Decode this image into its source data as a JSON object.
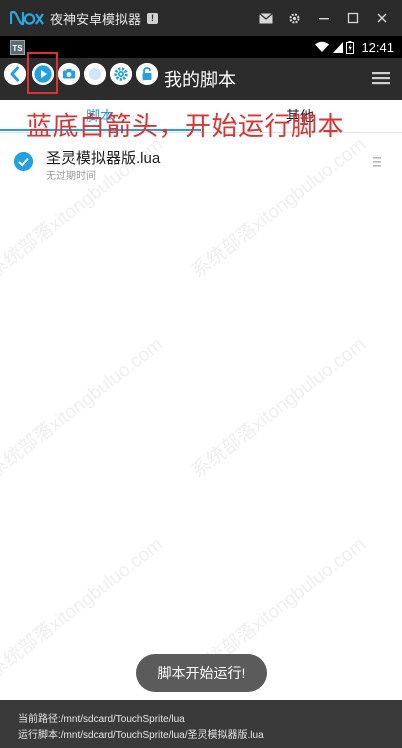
{
  "emulator": {
    "title": "夜神安卓模拟器",
    "badge": "!"
  },
  "status_bar": {
    "app_badge": "TS",
    "time": "12:41"
  },
  "toolbar": {
    "title": "我的脚本"
  },
  "tabs": [
    {
      "label": "脚本",
      "active": true
    },
    {
      "label": "其他",
      "active": false
    }
  ],
  "annotation": "蓝底白箭头，开始运行脚本",
  "scripts": [
    {
      "name": "圣灵模拟器版.lua",
      "meta": "无过期时间",
      "selected": true
    }
  ],
  "watermark": "系统部落xitongbuluo.com",
  "toast": "脚本开始运行!",
  "footer": {
    "current_path": "当前路径:/mnt/sdcard/TouchSprite/lua",
    "running_script": "运行脚本:/mnt/sdcard/TouchSprite/lua/圣灵模拟器版.lua"
  },
  "colors": {
    "accent": "#1ea1e6",
    "annotation": "#e0312f",
    "toolbar": "#2c2c2c",
    "emulator_bar": "#2b2b2b"
  },
  "icons": {
    "toolbar": [
      "back-icon",
      "play-icon",
      "camera-icon",
      "record-icon",
      "gear-icon",
      "lock-icon",
      "menu-icon"
    ],
    "emulator": [
      "mail-icon",
      "settings-icon",
      "minimize-icon",
      "maximize-icon",
      "close-icon"
    ]
  }
}
